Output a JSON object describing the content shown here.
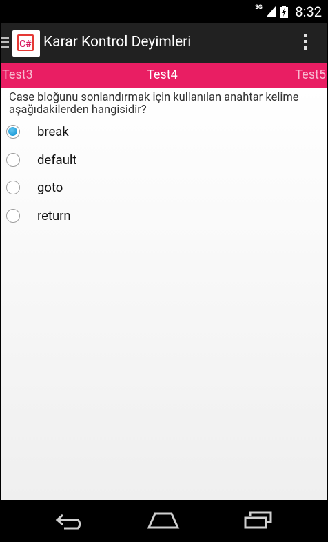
{
  "status": {
    "network": "3G",
    "time": "8:32"
  },
  "actionbar": {
    "title": "Karar Kontrol Deyimleri",
    "icon_text": "C#"
  },
  "tabs": {
    "prev": "Test3",
    "current": "Test4",
    "next": "Test5"
  },
  "question": "Case bloğunu sonlandırmak için kullanılan anahtar kelime aşağıdakilerden hangisidir?",
  "options": [
    "break",
    "default",
    "goto",
    "return"
  ],
  "selected_option": "break",
  "colors": {
    "accent": "#e91e63",
    "actionbar": "#212121",
    "radio_selected": "#0a8fd0"
  }
}
